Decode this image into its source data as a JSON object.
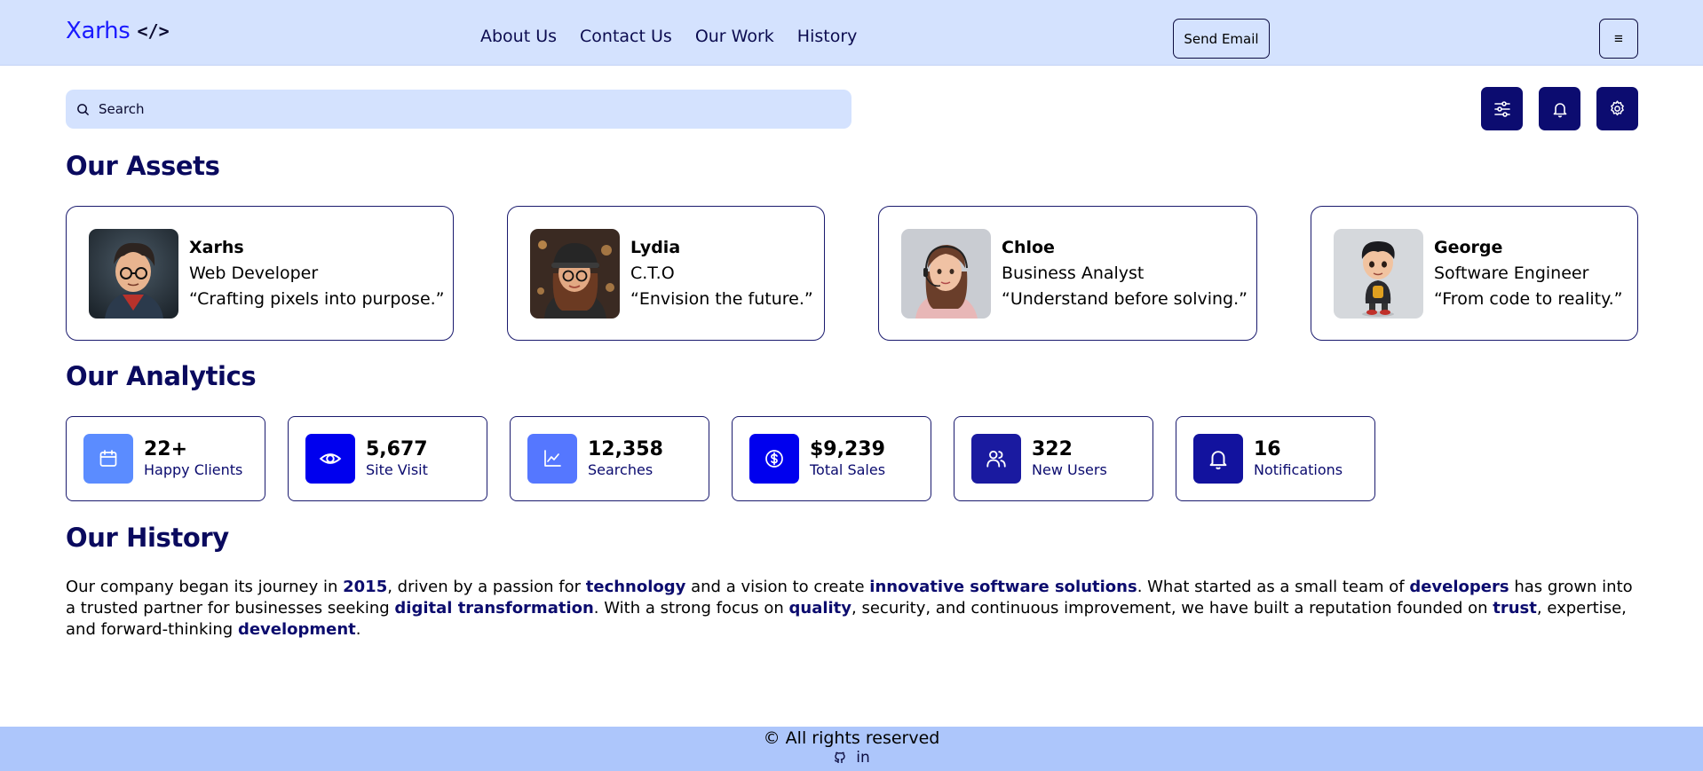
{
  "header": {
    "brand_name": "Xarhs",
    "brand_code": "</>",
    "nav": [
      "About Us",
      "Contact Us",
      "Our Work",
      "History"
    ],
    "send_email_label": "Send Email",
    "menu_icon": "≡"
  },
  "search": {
    "placeholder": "Search",
    "icon": "search-icon"
  },
  "toolbar": {
    "icons": [
      "sliders-icon",
      "bell-icon",
      "gear-icon"
    ],
    "color": "#0c0c70"
  },
  "assets": {
    "title": "Our Assets",
    "cards": [
      {
        "name": "Xarhs",
        "role": "Web Developer",
        "quote": "“Crafting pixels into purpose.”"
      },
      {
        "name": "Lydia",
        "role": "C.T.O",
        "quote": "“Envision the future.”"
      },
      {
        "name": "Chloe",
        "role": "Business Analyst",
        "quote": "“Understand before solving.”"
      },
      {
        "name": "George",
        "role": "Software Engineer",
        "quote": "“From code to reality.”"
      }
    ]
  },
  "analytics": {
    "title": "Our Analytics",
    "stats": [
      {
        "value": "22+",
        "label": "Happy Clients",
        "icon": "calendar-icon",
        "color": "#5b8cff"
      },
      {
        "value": "5,677",
        "label": "Site Visit",
        "icon": "eye-icon",
        "color": "#0000ee"
      },
      {
        "value": "12,358",
        "label": "Searches",
        "icon": "chart-icon",
        "color": "#5577ff"
      },
      {
        "value": "$9,239",
        "label": "Total Sales",
        "icon": "dollar-icon",
        "color": "#0000ee"
      },
      {
        "value": "322",
        "label": "New Users",
        "icon": "users-icon",
        "color": "#1a1aa0"
      },
      {
        "value": "16",
        "label": "Notifications",
        "icon": "bell-icon",
        "color": "#12129e"
      }
    ]
  },
  "history": {
    "title": "Our History",
    "segments": [
      {
        "t": "Our company began its journey in ",
        "b": false
      },
      {
        "t": "2015",
        "b": true
      },
      {
        "t": ", driven by a passion for ",
        "b": false
      },
      {
        "t": "technology",
        "b": true
      },
      {
        "t": " and a vision to create ",
        "b": false
      },
      {
        "t": "innovative software solutions",
        "b": true
      },
      {
        "t": ". What started as a small team of ",
        "b": false
      },
      {
        "t": "developers",
        "b": true
      },
      {
        "t": " has grown into a trusted partner for businesses seeking ",
        "b": false
      },
      {
        "t": "digital transformation",
        "b": true
      },
      {
        "t": ". With a strong focus on ",
        "b": false
      },
      {
        "t": "quality",
        "b": true
      },
      {
        "t": ", security, and continuous improvement, we have built a reputation founded on ",
        "b": false
      },
      {
        "t": "trust",
        "b": true
      },
      {
        "t": ", expertise, and forward-thinking ",
        "b": false
      },
      {
        "t": "development",
        "b": true
      },
      {
        "t": ".",
        "b": false
      }
    ]
  },
  "footer": {
    "copyright": "© All rights reserved",
    "github": "github-icon",
    "linkedin": "in"
  }
}
